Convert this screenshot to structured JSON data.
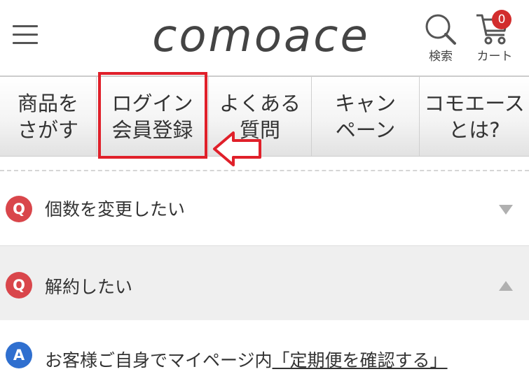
{
  "header": {
    "logo": "comoace",
    "search_label": "検索",
    "cart_label": "カート",
    "cart_count": "0"
  },
  "nav": {
    "items": [
      {
        "label": "商品を\nさがす"
      },
      {
        "label": "ログイン\n会員登録"
      },
      {
        "label": "よくある\n質問"
      },
      {
        "label": "キャン\nペーン"
      },
      {
        "label": "コモエース\nとは?"
      }
    ]
  },
  "faq": {
    "items": [
      {
        "badge": "Q",
        "question": "個数を変更したい",
        "expanded": false
      },
      {
        "badge": "Q",
        "question": "解約したい",
        "expanded": true
      }
    ],
    "answer": {
      "badge": "A",
      "text": "お客様ご自身でマイページ内",
      "link": "「定期便を確認する」"
    }
  },
  "colors": {
    "highlight": "#e0202a",
    "q_badge": "#d9464b",
    "a_badge": "#2f6fcf",
    "cart_badge": "#d22d2d"
  }
}
